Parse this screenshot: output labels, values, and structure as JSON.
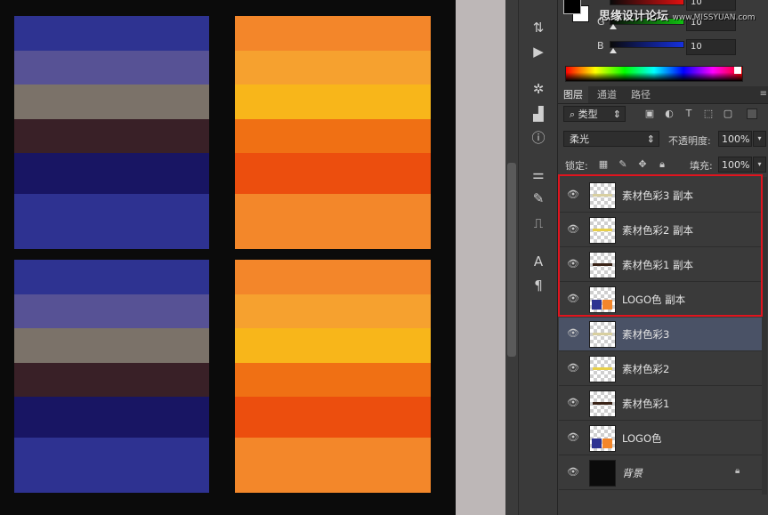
{
  "canvas": {
    "swatches": [
      {
        "name": "blue-palette-top",
        "colors": [
          "#2e3391",
          "#575295",
          "#7b7269",
          "#392027",
          "#181563",
          "#2e3291"
        ],
        "weights": [
          1,
          1,
          1,
          1,
          1.2,
          1.6
        ]
      },
      {
        "name": "orange-palette-top",
        "colors": [
          "#f3862a",
          "#f6a12f",
          "#f8b61a",
          "#f07014",
          "#ec4e0e",
          "#f3872a"
        ],
        "weights": [
          1,
          1,
          1,
          1,
          1.2,
          1.6
        ]
      },
      {
        "name": "blue-palette-bottom",
        "colors": [
          "#2e3391",
          "#575295",
          "#7b7269",
          "#392027",
          "#181563",
          "#2e3291"
        ],
        "weights": [
          1,
          1,
          1,
          1,
          1.2,
          1.6
        ]
      },
      {
        "name": "orange-palette-bottom",
        "colors": [
          "#f3862a",
          "#f6a12f",
          "#f8b61a",
          "#f07014",
          "#ec4e0e",
          "#f3872a"
        ],
        "weights": [
          1,
          1,
          1,
          1,
          1.2,
          1.6
        ]
      }
    ]
  },
  "color_panel": {
    "g_label": "G",
    "b_label": "B",
    "r_value": "10",
    "g_value": "10",
    "b_value": "10",
    "fg_color": "#000000",
    "bg_color": "#ffffff"
  },
  "watermark": {
    "main": "思缘设计论坛",
    "sub": "www.MISSYUAN.com"
  },
  "layers_panel": {
    "tabs": [
      "图层",
      "通道",
      "路径"
    ],
    "active_tab": 0,
    "filter_label": "类型",
    "blend_mode": "柔光",
    "opacity_label": "不透明度:",
    "opacity_value": "100%",
    "lock_label": "锁定:",
    "fill_label": "填充:",
    "fill_value": "100%",
    "layers": [
      {
        "name": "素材色彩3 副本",
        "thumb": "bar-beige"
      },
      {
        "name": "素材色彩2 副本",
        "thumb": "bar-yellow"
      },
      {
        "name": "素材色彩1 副本",
        "thumb": "bar-brown"
      },
      {
        "name": "LOGO色 副本",
        "thumb": "logo-blue-orange"
      },
      {
        "name": "素材色彩3",
        "thumb": "bar-beige",
        "selected": true
      },
      {
        "name": "素材色彩2",
        "thumb": "bar-yellow"
      },
      {
        "name": "素材色彩1",
        "thumb": "bar-brown"
      },
      {
        "name": "LOGO色",
        "thumb": "logo-blue-orange"
      },
      {
        "name": "背景",
        "thumb": "black-fill",
        "locked": true
      }
    ]
  },
  "colors": {
    "highlight_border": "#e0141e",
    "selected_layer": "#4a5266"
  }
}
